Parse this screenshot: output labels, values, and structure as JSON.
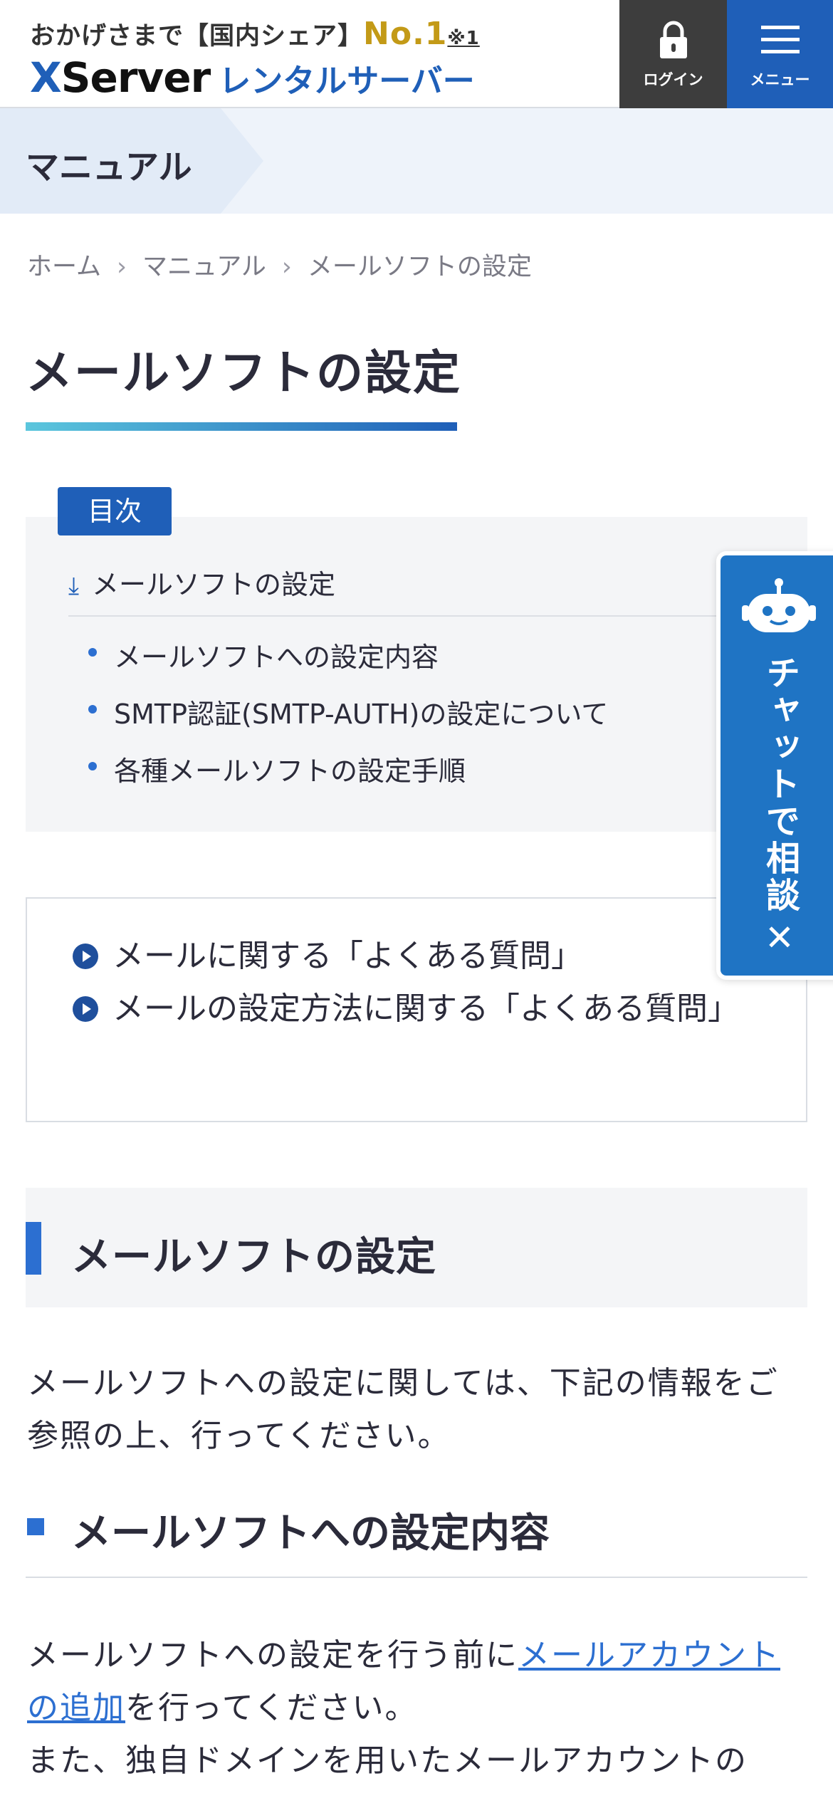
{
  "header": {
    "tagline_prefix": "おかげさまで【国内シェア】",
    "tagline_no1": "No.1",
    "tagline_note": "※1",
    "brand_x": "X",
    "brand_server": "Server",
    "brand_sub": "レンタルサーバー",
    "login_label": "ログイン",
    "menu_label": "メニュー"
  },
  "banner": {
    "title": "マニュアル"
  },
  "breadcrumb": {
    "items": [
      "ホーム",
      "マニュアル",
      "メールソフトの設定"
    ],
    "separator": "›"
  },
  "page": {
    "title": "メールソフトの設定"
  },
  "toc": {
    "label": "目次",
    "main": "メールソフトの設定",
    "subs": [
      "メールソフトへの設定内容",
      "SMTP認証(SMTP-AUTH)の設定について",
      "各種メールソフトの設定手順"
    ]
  },
  "faq": {
    "items": [
      "メールに関する「よくある質問」",
      "メールの設定方法に関する「よくある質問」"
    ]
  },
  "section": {
    "heading": "メールソフトの設定",
    "intro": "メールソフトへの設定に関しては、下記の情報をご参照の上、行ってください。",
    "subheading": "メールソフトへの設定内容",
    "para_before_link": "メールソフトへの設定を行う前に",
    "para_link": "メールアカウントの追加",
    "para_after_link": "を行ってください。",
    "para2": "また、独自ドメインを用いたメールアカウントの"
  },
  "chat": {
    "label": "チャットで相談",
    "close": "✕"
  },
  "colors": {
    "brand_blue": "#1f5fb8",
    "accent_blue": "#2c6fd1",
    "gold": "#c39a17"
  }
}
